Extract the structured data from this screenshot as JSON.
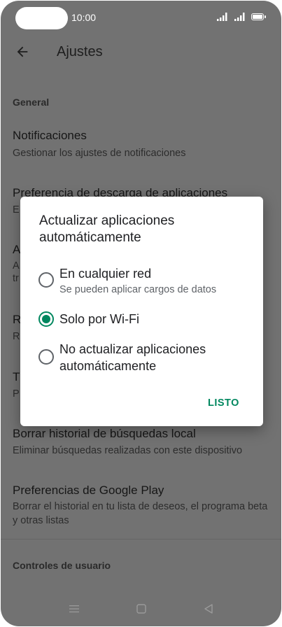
{
  "status_bar": {
    "time": "10:00"
  },
  "app_bar": {
    "title": "Ajustes"
  },
  "sections": [
    {
      "header": "General"
    },
    {
      "header": "Controles de usuario"
    }
  ],
  "settings": [
    {
      "title": "Notificaciones",
      "subtitle": "Gestionar los ajustes de notificaciones"
    },
    {
      "title": "Preferencia de descarga de aplicaciones",
      "subtitle": "E"
    },
    {
      "title": "A",
      "subtitle": "A\ntr"
    },
    {
      "title": "R",
      "subtitle": "R"
    },
    {
      "title": "T",
      "subtitle": "P"
    },
    {
      "title": "Borrar historial de búsquedas local",
      "subtitle": "Eliminar búsquedas realizadas con este dispositivo"
    },
    {
      "title": "Preferencias de Google Play",
      "subtitle": "Borrar el historial en tu lista de deseos, el programa beta y otras listas"
    }
  ],
  "dialog": {
    "title": "Actualizar aplicaciones automáticamente",
    "options": [
      {
        "label": "En cualquier red",
        "subtitle": "Se pueden aplicar cargos de datos",
        "selected": false
      },
      {
        "label": "Solo por Wi-Fi",
        "selected": true
      },
      {
        "label": "No actualizar aplicaciones automáticamente",
        "selected": false
      }
    ],
    "done_label": "LISTO"
  },
  "colors": {
    "accent": "#01875f",
    "scrim_background": "#727272",
    "dialog_background": "#ffffff"
  },
  "icons": {
    "back": "arrow-left-icon",
    "nav_menu": "menu-icon",
    "nav_home": "square-home-icon",
    "nav_back": "triangle-back-icon"
  }
}
